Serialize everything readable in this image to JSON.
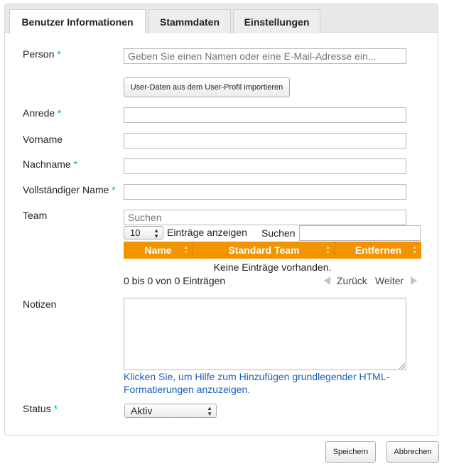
{
  "tabs": [
    {
      "label": "Benutzer Informationen",
      "active": true
    },
    {
      "label": "Stammdaten",
      "active": false
    },
    {
      "label": "Einstellungen",
      "active": false
    }
  ],
  "form": {
    "required_marker": "*",
    "person": {
      "label": "Person",
      "placeholder": "Geben Sie einen Namen oder eine E-Mail-Adresse ein...",
      "required": true
    },
    "import_button": "User-Daten aus dem User-Profil importieren",
    "anrede": {
      "label": "Anrede",
      "value": "",
      "required": true
    },
    "vorname": {
      "label": "Vorname",
      "value": "",
      "required": false
    },
    "nachname": {
      "label": "Nachname",
      "value": "",
      "required": true
    },
    "full_name": {
      "label": "Vollständiger Name",
      "value": "",
      "required": true
    },
    "team": {
      "label": "Team",
      "search_placeholder": "Suchen",
      "page_size": "10",
      "entries_label": "Einträge anzeigen",
      "filter_label": "Suchen",
      "filter_value": "",
      "columns": [
        "Name",
        "Standard Team",
        "Entfernen"
      ],
      "empty_text": "Keine Einträge vorhanden.",
      "info": "0 bis 0 von 0 Einträgen",
      "prev_label": "Zurück",
      "next_label": "Weiter"
    },
    "notes": {
      "label": "Notizen",
      "value": ""
    },
    "help_link": "Klicken Sie, um Hilfe zum Hinzufügen grundlegender HTML-Formatierungen anzuzeigen.",
    "status": {
      "label": "Status",
      "value": "Aktiv",
      "required": true
    }
  },
  "actions": {
    "save": "Speichern",
    "cancel": "Abbrechen"
  },
  "colors": {
    "accent": "#f29400",
    "required": "#00a0b4",
    "link": "#1a5fb4"
  }
}
